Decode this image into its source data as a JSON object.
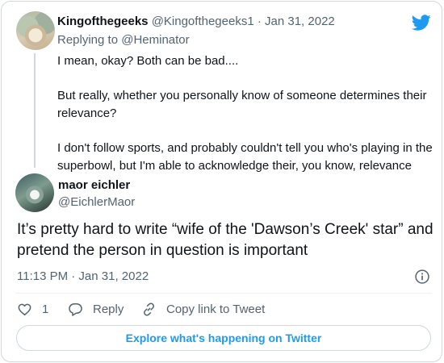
{
  "parent_tweet": {
    "display_name": "Kingofthegeeks",
    "handle": "@Kingofthegeeks1",
    "date": "Jan 31, 2022",
    "separator": " · ",
    "replying_prefix": "Replying to ",
    "replying_handle": "@Heminator",
    "paragraphs": [
      "I mean, okay? Both can be bad....",
      "But really, whether you personally know of someone determines their relevance?",
      "I don't follow sports, and probably couldn't tell you who's playing in the superbowl, but I'm able to acknowledge their, you know, relevance"
    ]
  },
  "main_tweet": {
    "display_name": "maor eichler",
    "handle": "@EichlerMaor",
    "text": "It’s pretty hard to write “wife of the 'Dawson’s Creek' star” and pretend the person in question is important",
    "timestamp": "11:13 PM · Jan 31, 2022"
  },
  "actions": {
    "like_count": "1",
    "reply_label": "Reply",
    "copy_link_label": "Copy link to Tweet"
  },
  "footer": {
    "explore_label": "Explore what's happening on Twitter"
  },
  "colors": {
    "twitter_blue": "#1d9bf0",
    "secondary_text": "#536471",
    "border": "#cfd9de"
  },
  "icons": {
    "brand": "twitter-bird-icon",
    "info": "info-icon",
    "like": "heart-icon",
    "reply": "reply-bubble-icon",
    "copy_link": "link-icon"
  }
}
